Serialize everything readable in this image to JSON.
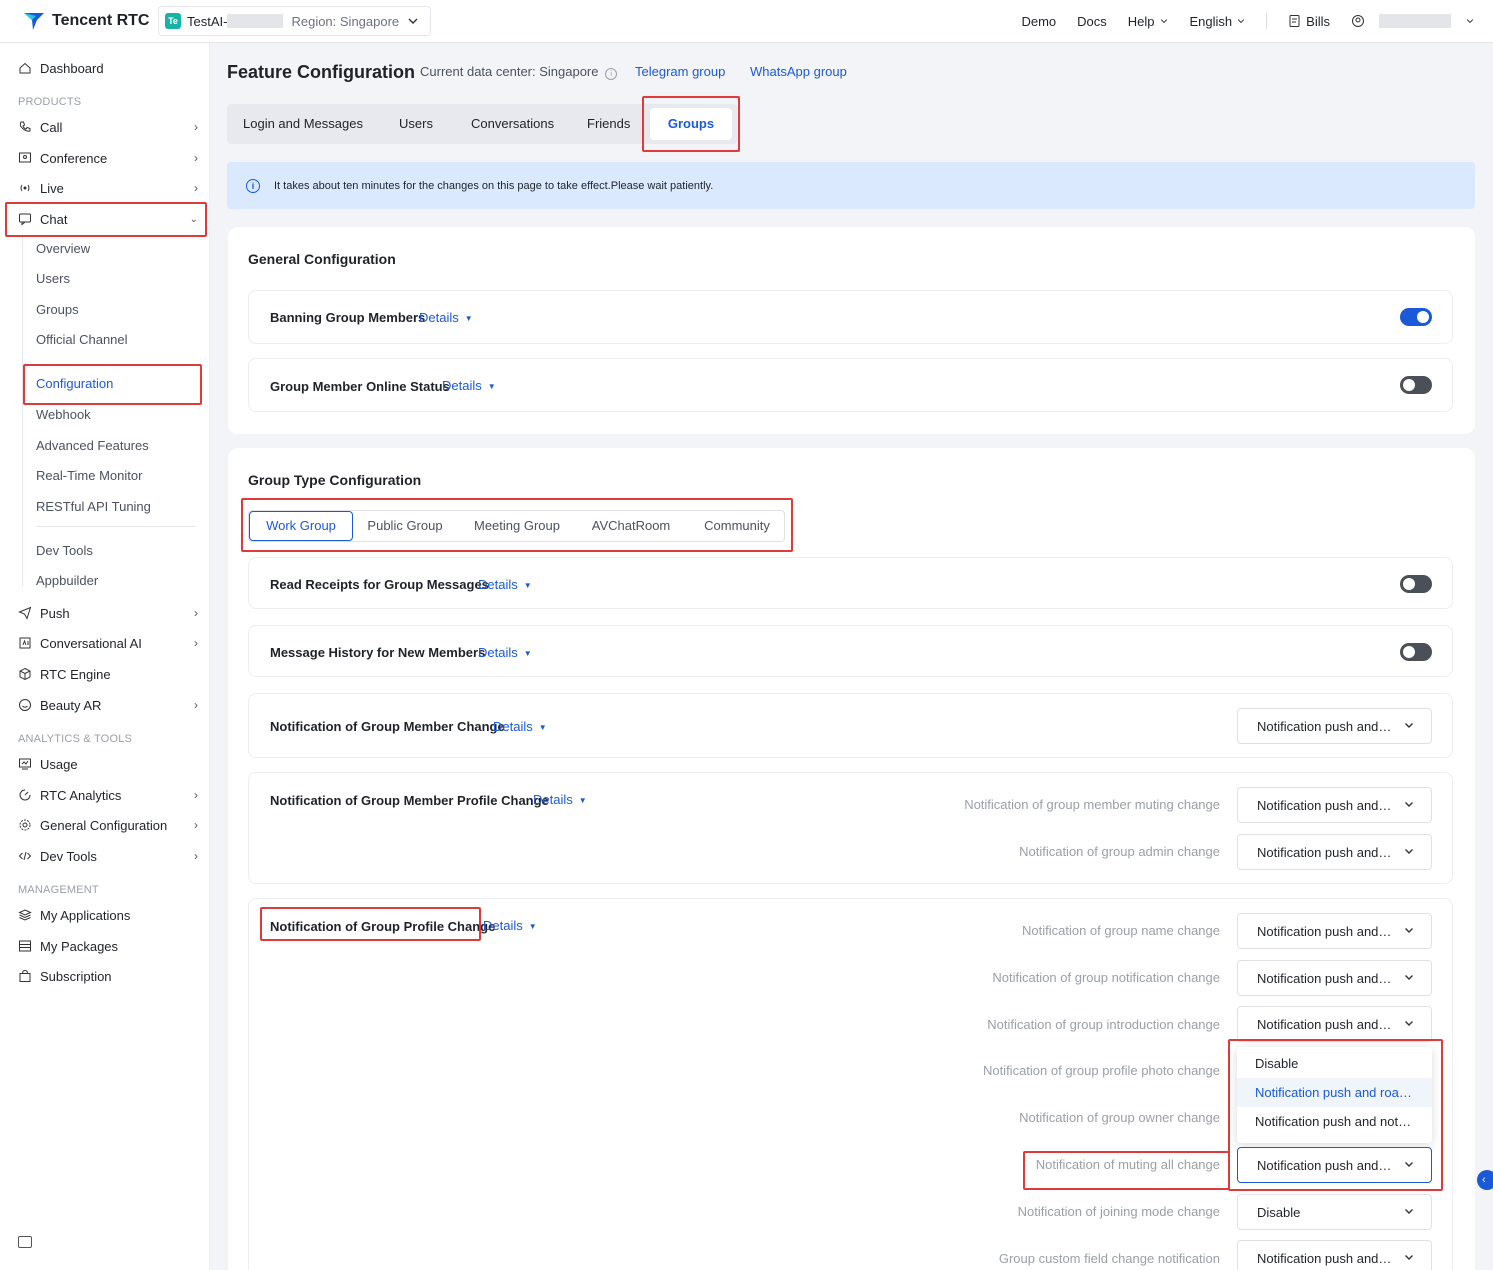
{
  "brand": {
    "name": "Tencent RTC"
  },
  "app_switch": {
    "badge": "Te",
    "name": "TestAI-",
    "region": "Region: Singapore"
  },
  "top_nav": {
    "demo": "Demo",
    "docs": "Docs",
    "help": "Help",
    "language": "English",
    "bills": "Bills"
  },
  "sidebar": {
    "dashboard": "Dashboard",
    "section_products": "PRODUCTS",
    "call": "Call",
    "conference": "Conference",
    "live": "Live",
    "chat": "Chat",
    "chat_sub": [
      "Overview",
      "Users",
      "Groups",
      "Official Channel",
      "Configuration",
      "Webhook",
      "Advanced Features",
      "Real-Time Monitor",
      "RESTful API Tuning",
      "Dev Tools",
      "Appbuilder"
    ],
    "push": "Push",
    "conversational_ai": "Conversational AI",
    "rtc_engine": "RTC Engine",
    "beauty_ar": "Beauty AR",
    "section_analytics": "ANALYTICS & TOOLS",
    "usage": "Usage",
    "rtc_analytics": "RTC Analytics",
    "general_configuration": "General Configuration",
    "dev_tools": "Dev Tools",
    "section_management": "MANAGEMENT",
    "my_applications": "My Applications",
    "my_packages": "My Packages",
    "subscription": "Subscription"
  },
  "header": {
    "title": "Feature Configuration",
    "datacenter": "Current data center: Singapore",
    "telegram": "Telegram group",
    "whatsapp": "WhatsApp group"
  },
  "tabs": [
    "Login and Messages",
    "Users",
    "Conversations",
    "Friends",
    "Groups"
  ],
  "notice": "It takes about ten minutes for the changes on this page to take effect.Please wait patiently.",
  "details_label": "Details",
  "general": {
    "title": "General Configuration",
    "banning": {
      "label": "Banning Group Members",
      "enabled": true
    },
    "online_status": {
      "label": "Group Member Online Status",
      "enabled": false
    }
  },
  "group_type": {
    "title": "Group Type Configuration",
    "types": [
      "Work Group",
      "Public Group",
      "Meeting Group",
      "AVChatRoom",
      "Community"
    ],
    "read_receipts": {
      "label": "Read Receipts for Group Messages",
      "enabled": false
    },
    "history": {
      "label": "Message History for New Members",
      "enabled": false
    },
    "member_change": {
      "label": "Notification of Group Member Change",
      "value": "Notification push and roaming"
    },
    "member_profile": {
      "label": "Notification of Group Member Profile Change",
      "items": [
        {
          "label": "Notification of group member muting change",
          "value": "Notification push and roaming"
        },
        {
          "label": "Notification of group admin change",
          "value": "Notification push and roaming"
        }
      ]
    },
    "group_profile": {
      "label": "Notification of Group Profile Change",
      "items": [
        {
          "label": "Notification of group name change",
          "value": "Notification push and roaming"
        },
        {
          "label": "Notification of group notification change",
          "value": "Notification push and roaming"
        },
        {
          "label": "Notification of group introduction change",
          "value": "Notification push and roaming"
        },
        {
          "label": "Notification of group profile photo change"
        },
        {
          "label": "Notification of group owner change"
        },
        {
          "label": "Notification of muting all change",
          "value": "Notification push and roaming"
        },
        {
          "label": "Notification of joining mode change",
          "value": "Disable"
        },
        {
          "label": "Group custom field change notification",
          "value": "Notification push and roaming"
        }
      ]
    },
    "dropdown_options": [
      "Disable",
      "Notification push and roaming",
      "Notification push and not roaming"
    ]
  },
  "colors": {
    "accent": "#1a5ad8",
    "highlight": "#e03a3a",
    "notice_bg": "#dbe9fe"
  }
}
